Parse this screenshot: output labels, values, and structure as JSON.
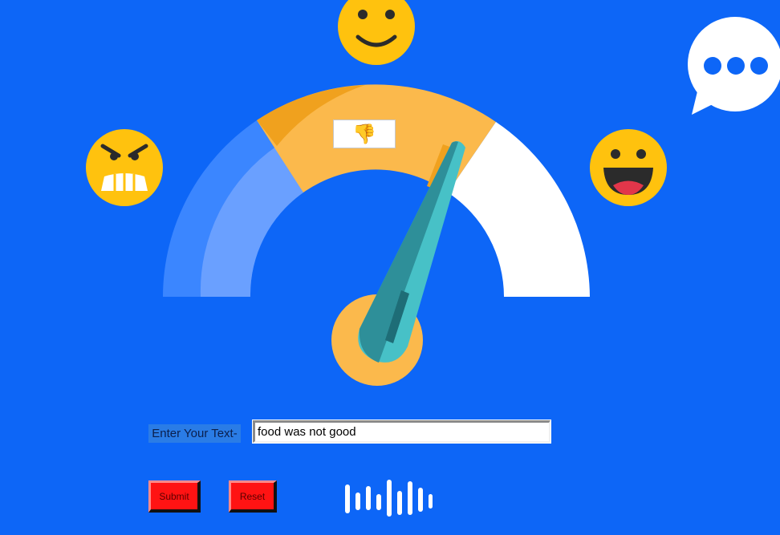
{
  "app": {
    "sentiment_result_icon": "thumbs-down-icon",
    "sentiment_result_glyph": "👎",
    "input_label": "Enter Your Text-",
    "input_value": "food was not good",
    "submit_label": "Submit",
    "reset_label": "Reset",
    "voice_icon": "sound-wave-icon"
  },
  "gauge": {
    "segments": [
      "negative",
      "neutral",
      "positive"
    ],
    "needle_position": "neutral/positive boundary"
  },
  "colors": {
    "background": "#0d66f7",
    "emoji_yellow": "#ffc20e",
    "gauge_blue": "#6aa0ff",
    "gauge_orange": "#fbb94c",
    "gauge_white": "#ffffff",
    "needle": "#47c1c7",
    "button_red": "#ff1313"
  }
}
